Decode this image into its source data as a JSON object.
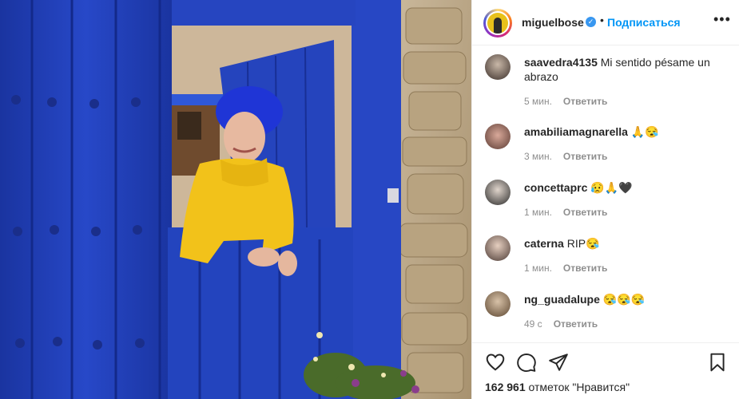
{
  "post": {
    "image_alt": "Woman in yellow sweater leaning over a blue wooden door",
    "author": "miguelbose",
    "follow_label": "Подписаться",
    "separator": "•",
    "more_label": "•••"
  },
  "comments": [
    {
      "user": "saavedra4135",
      "text": "Mi sentido pésame un abrazo",
      "time": "5 мин.",
      "reply": "Ответить"
    },
    {
      "user": "amabiliamagnarella",
      "text": "🙏😪",
      "time": "3 мин.",
      "reply": "Ответить"
    },
    {
      "user": "concettaprc",
      "text": "😥🙏🖤",
      "time": "1 мин.",
      "reply": "Ответить"
    },
    {
      "user": "caterna",
      "text": "RIP😪",
      "time": "1 мин.",
      "reply": "Ответить"
    },
    {
      "user": "ng_guadalupe",
      "text": "😪😪😪",
      "time": "49 с",
      "reply": "Ответить"
    }
  ],
  "footer": {
    "likes_count": "162 961",
    "likes_label": "отметок \"Нравится\""
  },
  "colors": {
    "link": "#0095f6",
    "door_blue": "#1e3fb0",
    "text": "#262626",
    "muted": "#8e8e8e"
  },
  "icons": [
    "heart-icon",
    "comment-icon",
    "share-icon",
    "bookmark-icon",
    "verified-icon"
  ]
}
